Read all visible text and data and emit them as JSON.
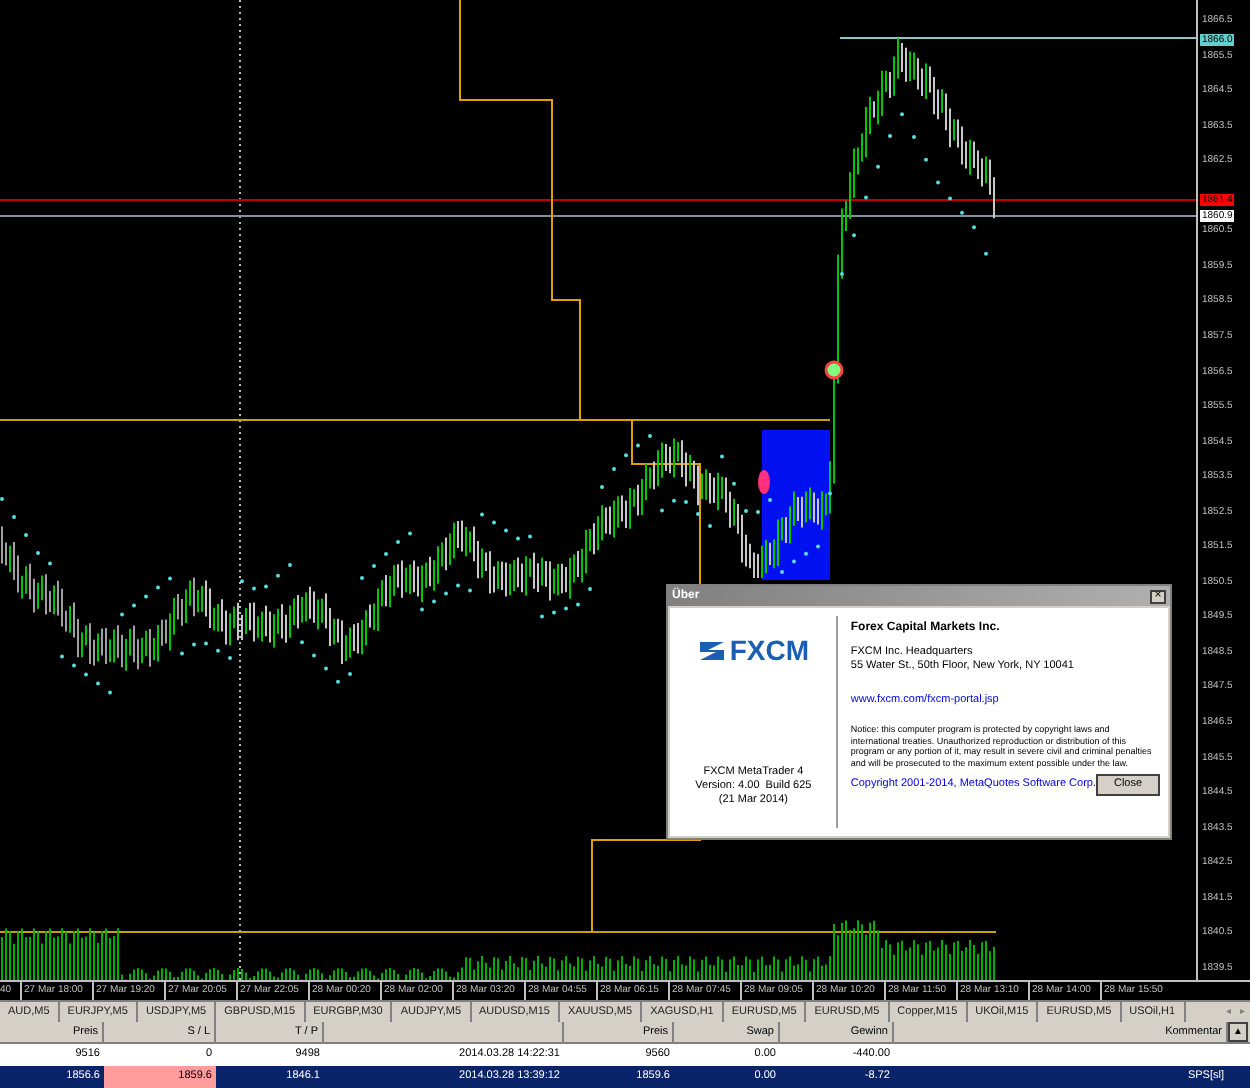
{
  "chart": {
    "price_labels": [
      "1866.5",
      "1865.5",
      "1864.5",
      "1863.5",
      "1862.5",
      "1860.5",
      "1859.5",
      "1858.5",
      "1857.5",
      "1856.5",
      "1855.5",
      "1854.5",
      "1853.5",
      "1852.5",
      "1851.5",
      "1850.5",
      "1849.5",
      "1848.5",
      "1847.5",
      "1846.5",
      "1845.5",
      "1844.5",
      "1843.5",
      "1842.5",
      "1841.5",
      "1840.5",
      "1839.5"
    ],
    "price_tags": [
      {
        "text": "1866.0",
        "color": "#66cccc"
      },
      {
        "text": "1861.4",
        "color": "#ff0000"
      },
      {
        "text": "1860.9",
        "color": "#ffffff"
      }
    ],
    "time_labels": [
      "40",
      "27 Mar 18:00",
      "27 Mar 19:20",
      "27 Mar 20:05",
      "27 Mar 22:05",
      "28 Mar 00:20",
      "28 Mar 02:00",
      "28 Mar 03:20",
      "28 Mar 04:55",
      "28 Mar 06:15",
      "28 Mar 07:45",
      "28 Mar 09:05",
      "28 Mar 10:20",
      "28 Mar 11:50",
      "28 Mar 13:10",
      "28 Mar 14:00",
      "28 Mar 15:50"
    ]
  },
  "dialog": {
    "title": "Über",
    "close_glyph": "×",
    "logo_text": "FXCM",
    "product_lines": [
      "FXCM MetaTrader 4",
      "Version: 4.00  Build 625",
      "(21 Mar 2014)"
    ],
    "company": "Forex Capital Markets Inc.",
    "address_lines": [
      "FXCM Inc. Headquarters",
      "55 Water St., 50th Floor, New York, NY 10041"
    ],
    "link": "www.fxcm.com/fxcm-portal.jsp",
    "notice": "Notice: this computer program is protected by copyright laws and international treaties. Unauthorized reproduction or distribution of this program or any portion of it, may result in severe civil and criminal penalties and will be prosecuted to the maximum extent possible under the law.",
    "copyright": "Copyright 2001-2014, MetaQuotes Software Corp.",
    "button": "Close"
  },
  "symbol_tabs": [
    "AUD,M5",
    "EURJPY,M5",
    "USDJPY,M5",
    "GBPUSD,M15",
    "EURGBP,M30",
    "AUDJPY,M5",
    "AUDUSD,M15",
    "XAUUSD,M5",
    "XAGUSD,H1",
    "EURUSD,M5",
    "EURUSD,M5",
    "Copper,M15",
    "UKOil,M15",
    "EURUSD,M5",
    "USOil,H1"
  ],
  "tab_scroll": [
    "◂",
    "▸"
  ],
  "table": {
    "columns": [
      "Preis",
      "S / L",
      "T / P",
      "",
      "Preis",
      "Swap",
      "Gewinn",
      "Kommentar"
    ],
    "rows": [
      {
        "selected": false,
        "stop_loss_alert": false,
        "cells": [
          "9516",
          "0",
          "9498",
          "2014.03.28 14:22:31",
          "9560",
          "0.00",
          "-440.00",
          ""
        ]
      },
      {
        "selected": true,
        "stop_loss_alert": true,
        "cells": [
          "1856.6",
          "1859.6",
          "1846.1",
          "2014.03.28 13:39:12",
          "1859.6",
          "0.00",
          "-8.72",
          "SPS[sl]"
        ]
      }
    ],
    "scroll_glyph": "▲"
  }
}
